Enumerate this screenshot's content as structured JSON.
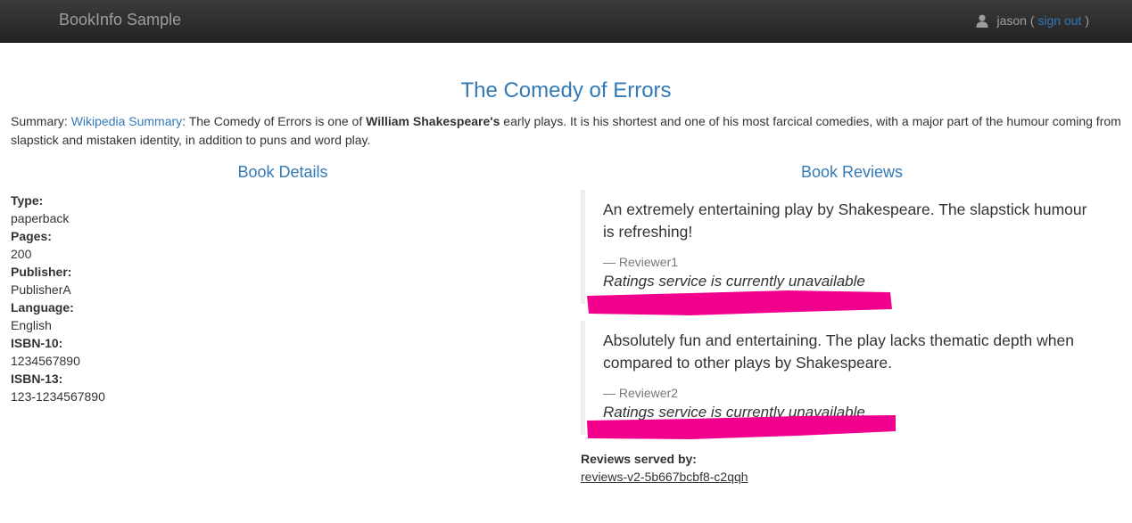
{
  "navbar": {
    "brand": "BookInfo Sample",
    "user": "jason",
    "paren_open": " ( ",
    "sign_out": "sign out",
    "paren_close": " )"
  },
  "page": {
    "title": "The Comedy of Errors",
    "summary_label": "Summary: ",
    "summary_link": "Wikipedia Summary",
    "summary_pre": ": The Comedy of Errors is one of ",
    "summary_bold": "William Shakespeare's",
    "summary_post": " early plays. It is his shortest and one of his most farcical comedies, with a major part of the humour coming from slapstick and mistaken identity, in addition to puns and word play."
  },
  "details": {
    "heading": "Book Details",
    "items": [
      {
        "label": "Type:",
        "value": "paperback"
      },
      {
        "label": "Pages:",
        "value": "200"
      },
      {
        "label": "Publisher:",
        "value": "PublisherA"
      },
      {
        "label": "Language:",
        "value": "English"
      },
      {
        "label": "ISBN-10:",
        "value": "1234567890"
      },
      {
        "label": "ISBN-13:",
        "value": "123-1234567890"
      }
    ]
  },
  "reviews": {
    "heading": "Book Reviews",
    "items": [
      {
        "text": "An extremely entertaining play by Shakespeare. The slapstick humour is refreshing!",
        "reviewer": "— Reviewer1",
        "rating": "Ratings service is currently unavailable"
      },
      {
        "text": "Absolutely fun and entertaining. The play lacks thematic depth when compared to other plays by Shakespeare.",
        "reviewer": "— Reviewer2",
        "rating": "Ratings service is currently unavailable"
      }
    ],
    "served_label": "Reviews served by:",
    "served_by": "reviews-v2-5b667bcbf8-c2qqh"
  },
  "colors": {
    "link": "#337ab7",
    "highlight": "#f0008c",
    "navbar": "#222222"
  },
  "icons": {
    "user": "user-icon"
  }
}
